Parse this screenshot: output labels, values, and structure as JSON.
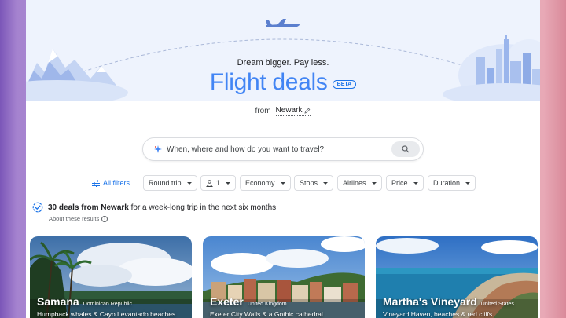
{
  "hero": {
    "tagline": "Dream bigger. Pay less.",
    "title": "Flight deals",
    "badge": "BETA",
    "from_label": "from",
    "origin": "Newark"
  },
  "search": {
    "placeholder": "When, where and how do you want to travel?"
  },
  "filters": {
    "all_filters": "All filters",
    "trip_type": "Round trip",
    "passengers": "1",
    "cabin": "Economy",
    "stops": "Stops",
    "airlines": "Airlines",
    "price": "Price",
    "duration": "Duration"
  },
  "results": {
    "count_text": "30 deals from Newark",
    "rest_text": " for a week-long trip in the next six months",
    "about": "About these results"
  },
  "cards": [
    {
      "city": "Samana",
      "country": "Dominican Republic",
      "description": "Humpback whales & Cayo Levantado beaches"
    },
    {
      "city": "Exeter",
      "country": "United Kingdom",
      "description": "Exeter City Walls & a Gothic cathedral"
    },
    {
      "city": "Martha's Vineyard",
      "country": "United States",
      "description": "Vineyard Haven, beaches & red cliffs"
    }
  ],
  "colors": {
    "accent": "#1a73e8",
    "title": "#4285f4",
    "hero_bg": "#eef3fd"
  },
  "icons": [
    "sparkle-icon",
    "search-icon",
    "pencil-icon",
    "tune-icon",
    "person-icon",
    "info-icon",
    "verified-check-icon"
  ]
}
